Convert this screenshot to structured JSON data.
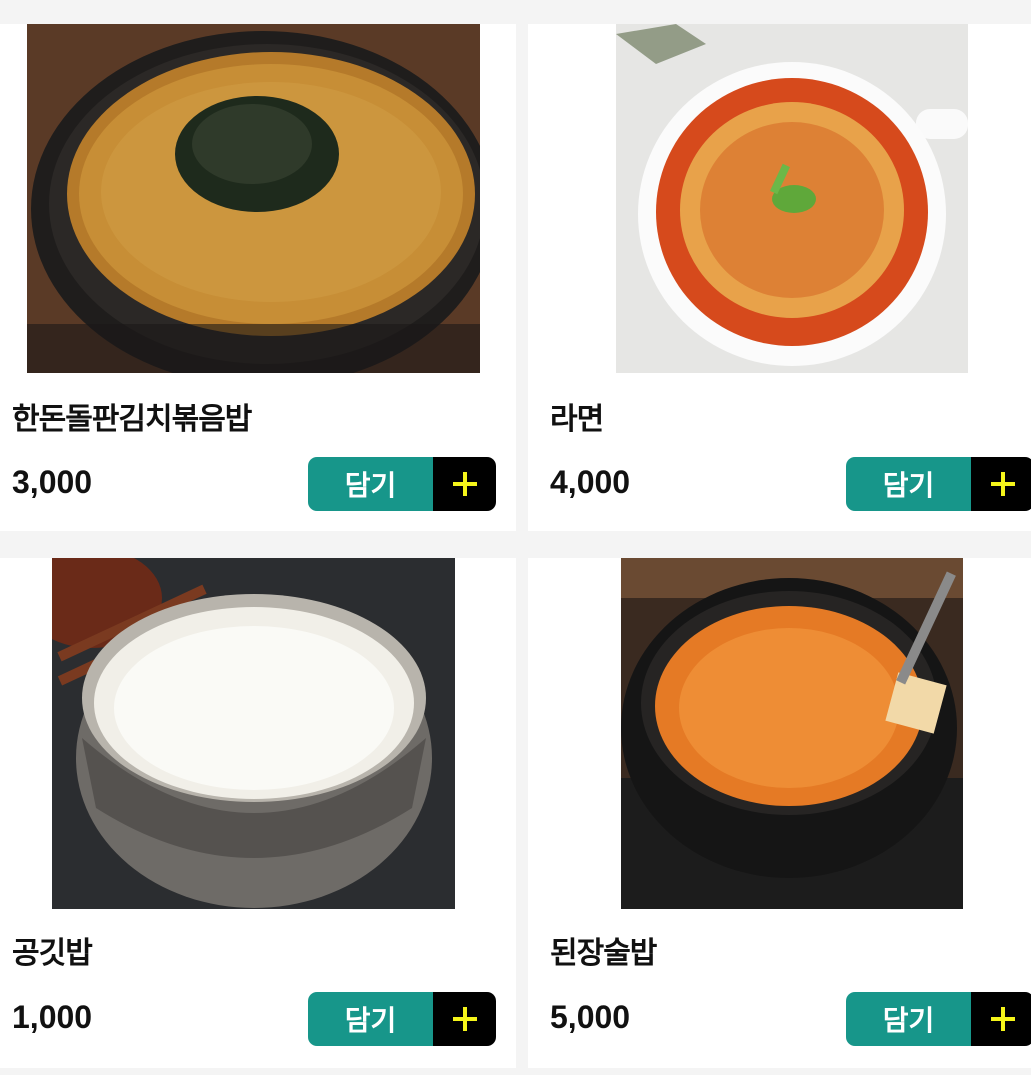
{
  "menu_items": [
    {
      "name": "한돈돌판김치볶음밥",
      "price": "3,000",
      "button_label": "담기",
      "image": "kimchi-fried-rice-stone-plate-photo"
    },
    {
      "name": "라면",
      "price": "4,000",
      "button_label": "담기",
      "image": "ramen-bowl-photo"
    },
    {
      "name": "공깃밥",
      "price": "1,000",
      "button_label": "담기",
      "image": "rice-bowl-photo"
    },
    {
      "name": "된장술밥",
      "price": "5,000",
      "button_label": "담기",
      "image": "doenjang-rice-stew-photo"
    }
  ],
  "colors": {
    "button_green": "#17968a",
    "button_black": "#000000",
    "plus_yellow": "#f5f51a",
    "background": "#f4f4f4"
  },
  "icons": {
    "add": "plus-icon"
  }
}
